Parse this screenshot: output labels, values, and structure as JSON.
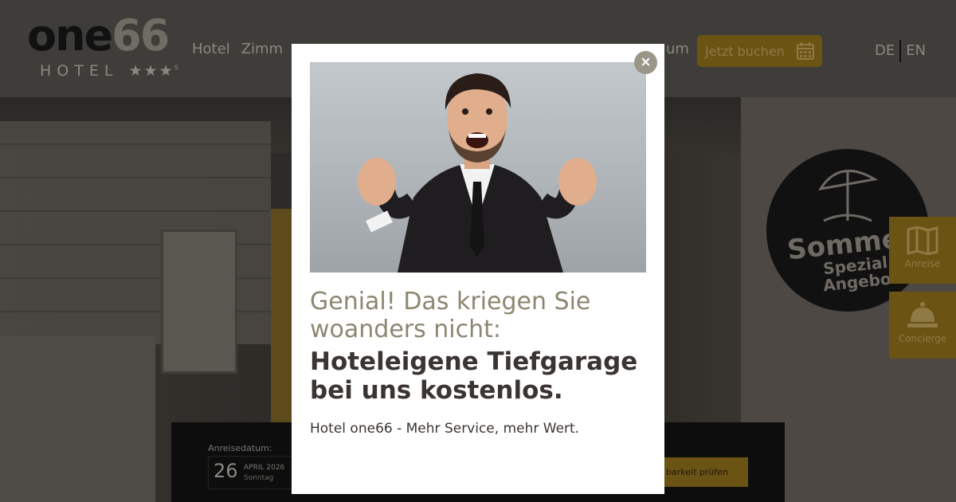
{
  "header": {
    "logo": {
      "text_main": "one",
      "text_num": "66",
      "text_sub": "HOTEL",
      "stars": "★★★",
      "stars_sup": "S"
    },
    "nav": [
      {
        "label": "Hotel"
      },
      {
        "label": "Zimm"
      }
    ],
    "nav_partial_right": "um",
    "book_button": {
      "label": "Jetzt buchen",
      "icon": "calendar-icon"
    },
    "languages": {
      "de": "DE",
      "en": "EN"
    }
  },
  "hero": {
    "badge": {
      "line1": "Somme",
      "line2": "Spezial",
      "line3": "Angebo",
      "icon": "umbrella-icon"
    },
    "side_tabs": [
      {
        "label": "Anreise",
        "icon": "map-icon"
      },
      {
        "label": "Concierge",
        "icon": "bell-icon"
      }
    ]
  },
  "booking": {
    "arrival_label": "Anreisedatum:",
    "arrival_day": "26",
    "arrival_month": "APRIL 2026",
    "arrival_weekday": "Sonntag",
    "check_button": "barkeit prüfen"
  },
  "modal": {
    "close_label": "×",
    "headline_1": "Genial! Das kriegen Sie woanders nicht:",
    "headline_2": "Hoteleigene Tiefgarage bei uns kostenlos.",
    "subline": "Hotel one66 - Mehr Service, mehr Wert."
  },
  "colors": {
    "accent_gold": "#6b5314",
    "modal_headline_light": "#8b8771",
    "modal_headline_dark": "#3a3532",
    "close_button": "#9b9788"
  }
}
